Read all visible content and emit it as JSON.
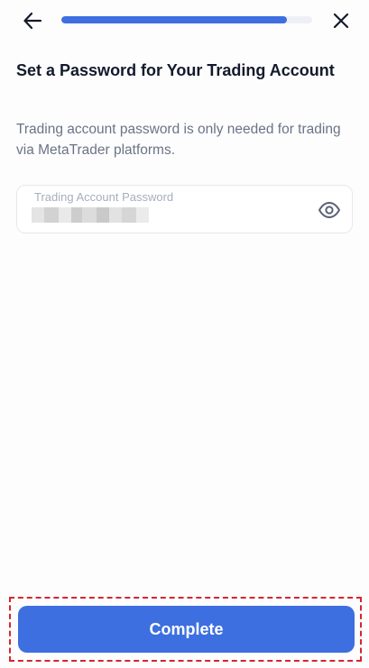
{
  "header": {
    "back_icon": "arrow-left-icon",
    "close_icon": "close-icon",
    "progress": 0.9,
    "progress_color": "#3d6fe0"
  },
  "main": {
    "title": "Set a Password for Your Trading Account",
    "description": "Trading account password is only needed for trading via MetaTrader platforms.",
    "password_field": {
      "label": "Trading Account Password",
      "value_masked": true,
      "visibility_icon": "eye-icon"
    }
  },
  "footer": {
    "complete_label": "Complete",
    "button_color": "#3d6fe0",
    "highlight_color": "#d6262e"
  }
}
